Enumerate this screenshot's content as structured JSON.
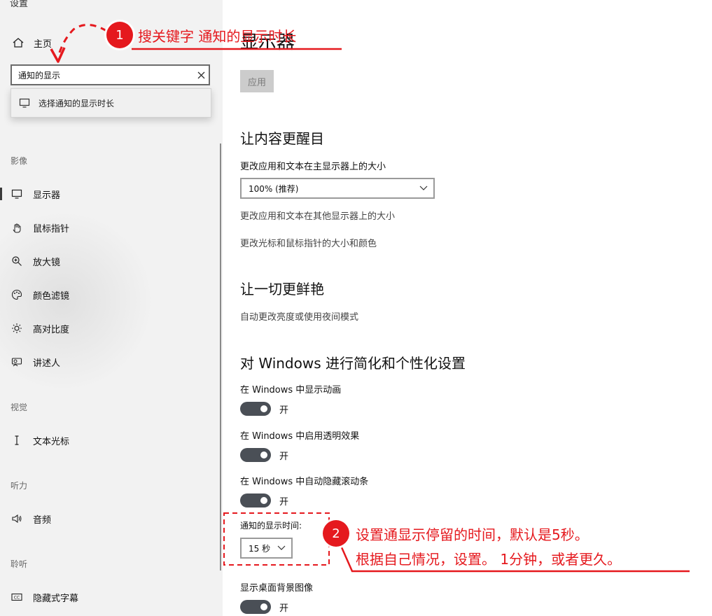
{
  "app_title": "设置",
  "sidebar": {
    "home_label": "主页",
    "search": {
      "value": "通知的显示"
    },
    "suggestion": "选择通知的显示时长",
    "sections": {
      "vision": "影像",
      "visual": "视觉",
      "hearing": "听力",
      "listening": "聆听"
    },
    "items": [
      {
        "label": "显示器",
        "icon": "monitor-icon",
        "active": true
      },
      {
        "label": "鼠标指针",
        "icon": "pointer-icon"
      },
      {
        "label": "放大镜",
        "icon": "magnifier-icon"
      },
      {
        "label": "颜色滤镜",
        "icon": "palette-icon"
      },
      {
        "label": "高对比度",
        "icon": "contrast-icon"
      },
      {
        "label": "讲述人",
        "icon": "narrator-icon"
      },
      {
        "label": "文本光标",
        "icon": "text-cursor-icon"
      },
      {
        "label": "音频",
        "icon": "speaker-icon"
      },
      {
        "label": "隐藏式字幕",
        "icon": "cc-icon"
      }
    ]
  },
  "main": {
    "title": "显示器",
    "apply_label": "应用",
    "section_bright": {
      "heading": "让内容更醒目",
      "size_label": "更改应用和文本在主显示器上的大小",
      "size_value": "100% (推荐)",
      "link_other": "更改应用和文本在其他显示器上的大小",
      "link_cursor": "更改光标和鼠标指针的大小和颜色"
    },
    "section_vivid": {
      "heading": "让一切更鲜艳",
      "link_night": "自动更改亮度或使用夜间模式"
    },
    "section_simplify": {
      "heading": "对 Windows 进行简化和个性化设置",
      "animations_label": "在 Windows 中显示动画",
      "transparency_label": "在 Windows 中启用透明效果",
      "scrollbars_label": "在 Windows 中自动隐藏滚动条",
      "notification_time_label": "通知的显示时间:",
      "notification_time_value": "15 秒",
      "desktop_bg_label": "显示桌面背景图像",
      "toggle_on": "开"
    }
  },
  "annotations": {
    "badge1": "1",
    "note1": "搜关键字 通知的显示时长",
    "badge2": "2",
    "note2_line1": "设置通显示停留的时间，默认是5秒。",
    "note2_line2": "根据自己情况，设置。 1分钟，或者更久。",
    "color": "#e5191e"
  }
}
